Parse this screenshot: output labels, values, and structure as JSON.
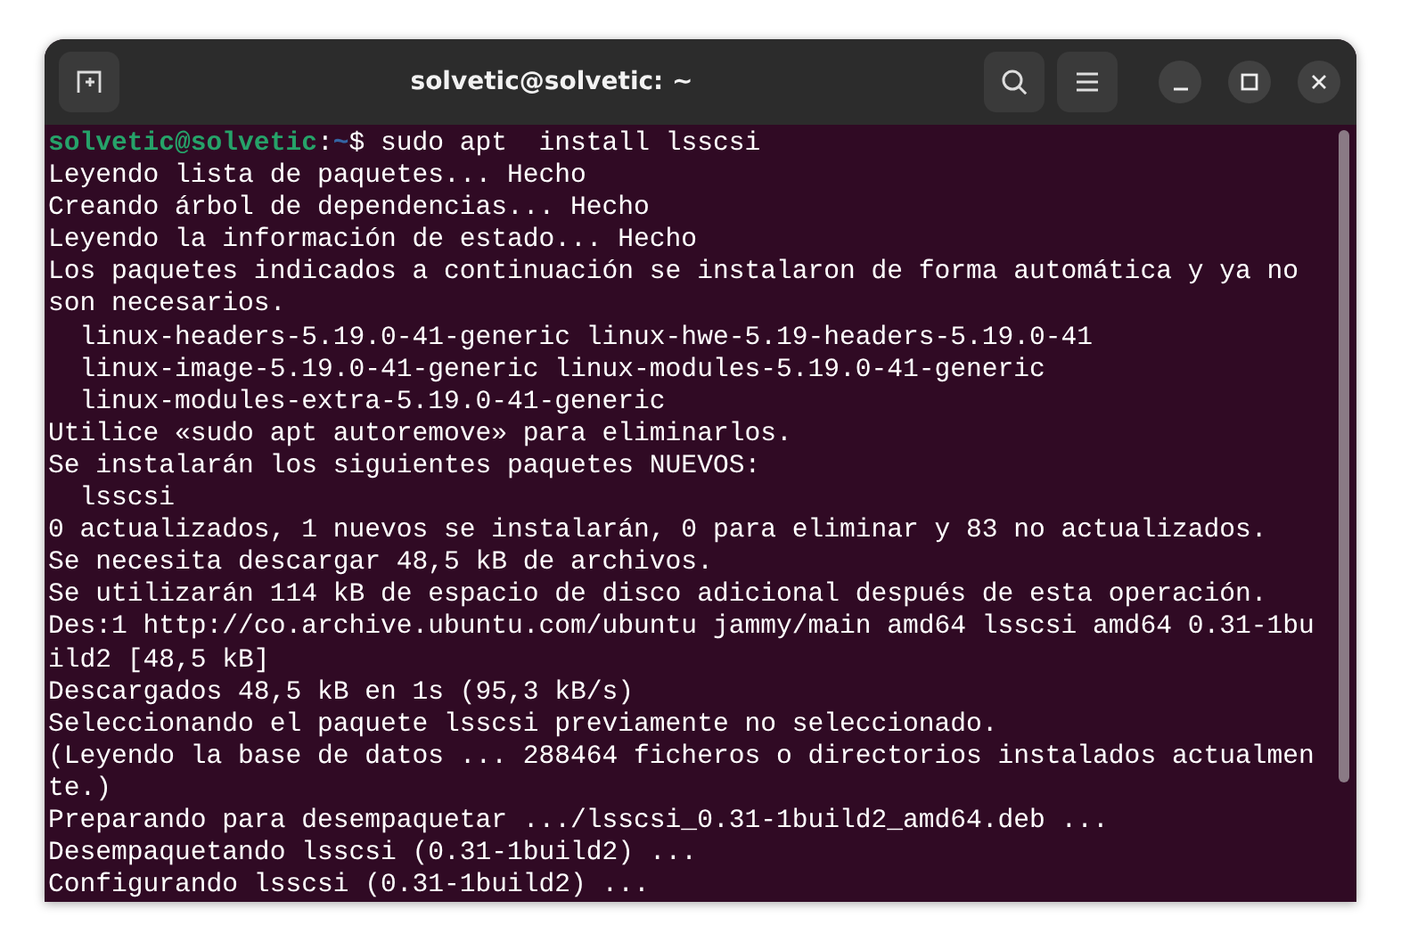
{
  "window": {
    "title": "solvetic@solvetic: ~"
  },
  "prompt": {
    "user_host": "solvetic@solvetic",
    "separator": ":",
    "path": "~",
    "command": "$ sudo apt  install lsscsi"
  },
  "output_lines": [
    "Leyendo lista de paquetes... Hecho",
    "Creando árbol de dependencias... Hecho",
    "Leyendo la información de estado... Hecho",
    "Los paquetes indicados a continuación se instalaron de forma automática y ya no",
    "son necesarios.",
    "  linux-headers-5.19.0-41-generic linux-hwe-5.19-headers-5.19.0-41",
    "  linux-image-5.19.0-41-generic linux-modules-5.19.0-41-generic",
    "  linux-modules-extra-5.19.0-41-generic",
    "Utilice «sudo apt autoremove» para eliminarlos.",
    "Se instalarán los siguientes paquetes NUEVOS:",
    "  lsscsi",
    "0 actualizados, 1 nuevos se instalarán, 0 para eliminar y 83 no actualizados.",
    "Se necesita descargar 48,5 kB de archivos.",
    "Se utilizarán 114 kB de espacio de disco adicional después de esta operación.",
    "Des:1 http://co.archive.ubuntu.com/ubuntu jammy/main amd64 lsscsi amd64 0.31-1bu",
    "ild2 [48,5 kB]",
    "Descargados 48,5 kB en 1s (95,3 kB/s)",
    "Seleccionando el paquete lsscsi previamente no seleccionado.",
    "(Leyendo la base de datos ... 288464 ficheros o directorios instalados actualmen",
    "te.)",
    "Preparando para desempaquetar .../lsscsi_0.31-1build2_amd64.deb ...",
    "Desempaquetando lsscsi (0.31-1build2) ...",
    "Configurando lsscsi (0.31-1build2) ..."
  ]
}
